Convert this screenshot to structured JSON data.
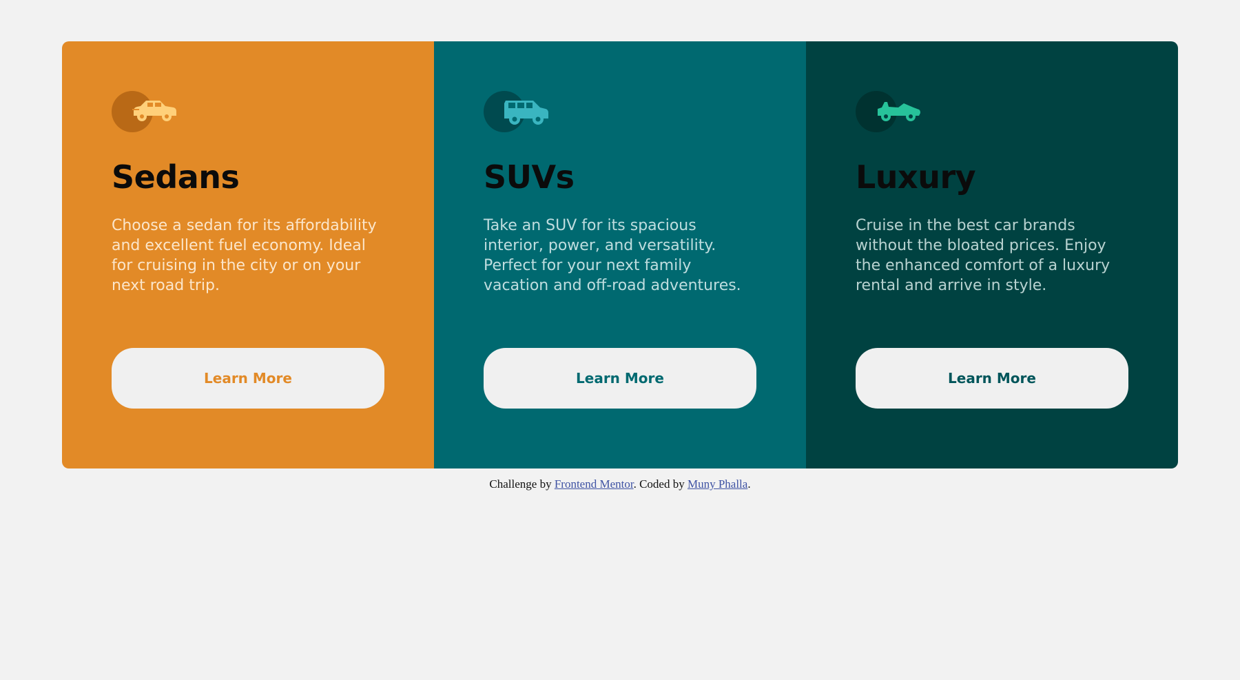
{
  "cards": [
    {
      "title": "Sedans",
      "description": "Choose a sedan for its affordability and excellent fuel economy. Ideal for cruising in the city or on your next road trip.",
      "button_label": "Learn More",
      "icon": "sedan-car-icon",
      "accent": "#e28a27",
      "icon_color": "#ffd07a"
    },
    {
      "title": "SUVs",
      "description": "Take an SUV for its spacious interior, power, and versatility. Perfect for your next family vacation and off-road adventures.",
      "button_label": "Learn More",
      "icon": "suv-car-icon",
      "accent": "#006970",
      "icon_color": "#3ab5c0"
    },
    {
      "title": "Luxury",
      "description": "Cruise in the best car brands without the bloated prices. Enjoy the enhanced comfort of a luxury rental and arrive in style.",
      "button_label": "Learn More",
      "icon": "luxury-car-icon",
      "accent": "#004241",
      "icon_color": "#27c29a"
    }
  ],
  "footer": {
    "prefix": "Challenge by",
    "challenge_link": "Frontend Mentor",
    "middle": ". Coded by",
    "author_link": "Muny Phalla",
    "suffix": "."
  }
}
